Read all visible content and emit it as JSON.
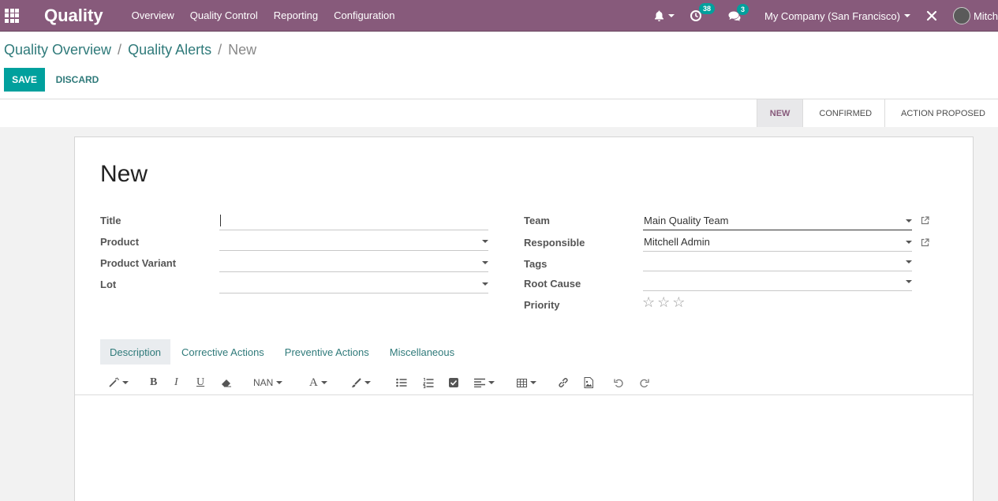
{
  "navbar": {
    "app_name": "Quality",
    "menu": [
      "Overview",
      "Quality Control",
      "Reporting",
      "Configuration"
    ],
    "activity_badge": "38",
    "messages_badge": "3",
    "company": "My Company (San Francisco)",
    "user": "Mitch"
  },
  "breadcrumb": {
    "items": [
      "Quality Overview",
      "Quality Alerts"
    ],
    "current": "New"
  },
  "actions": {
    "save": "SAVE",
    "discard": "DISCARD"
  },
  "stages": [
    "NEW",
    "CONFIRMED",
    "ACTION PROPOSED"
  ],
  "form": {
    "title": "New",
    "left_fields": [
      {
        "label": "Title",
        "value": ""
      },
      {
        "label": "Product",
        "value": ""
      },
      {
        "label": "Product Variant",
        "value": ""
      },
      {
        "label": "Lot",
        "value": ""
      }
    ],
    "right_fields": [
      {
        "label": "Team",
        "value": "Main Quality Team"
      },
      {
        "label": "Responsible",
        "value": "Mitchell Admin"
      },
      {
        "label": "Tags",
        "value": ""
      },
      {
        "label": "Root Cause",
        "value": ""
      },
      {
        "label": "Priority",
        "value": ""
      }
    ],
    "priority_stars": 3,
    "priority_value": 0
  },
  "tabs": [
    "Description",
    "Corrective Actions",
    "Preventive Actions",
    "Miscellaneous"
  ],
  "toolbar": {
    "font_size": "NAN"
  },
  "colors": {
    "navbar": "#875a7b",
    "primary": "#00a09d",
    "link": "#2f7a7a"
  }
}
